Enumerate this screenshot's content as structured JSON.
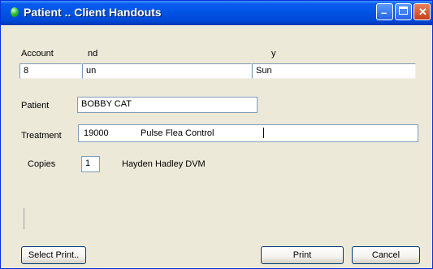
{
  "window": {
    "title": "Patient .. Client Handouts",
    "icon": "green-orb-icon"
  },
  "title_buttons": {
    "minimize": "minimize-icon",
    "maximize": "maximize-icon",
    "close": "close-icon"
  },
  "header": {
    "account_label": "Account",
    "name_label": "nd",
    "species_label": "y"
  },
  "account_row": {
    "account_value": "8",
    "name_value": "un",
    "species_value": "Sun"
  },
  "patient": {
    "label": "Patient",
    "value": "BOBBY CAT"
  },
  "treatment": {
    "label": "Treatment",
    "code": "19000",
    "description": "Pulse Flea Control"
  },
  "copies": {
    "label": "Copies",
    "value": "1",
    "note": "Hayden Hadley DVM"
  },
  "buttons": {
    "select_printer": "Select Print..",
    "print": "Print",
    "cancel": "Cancel"
  }
}
